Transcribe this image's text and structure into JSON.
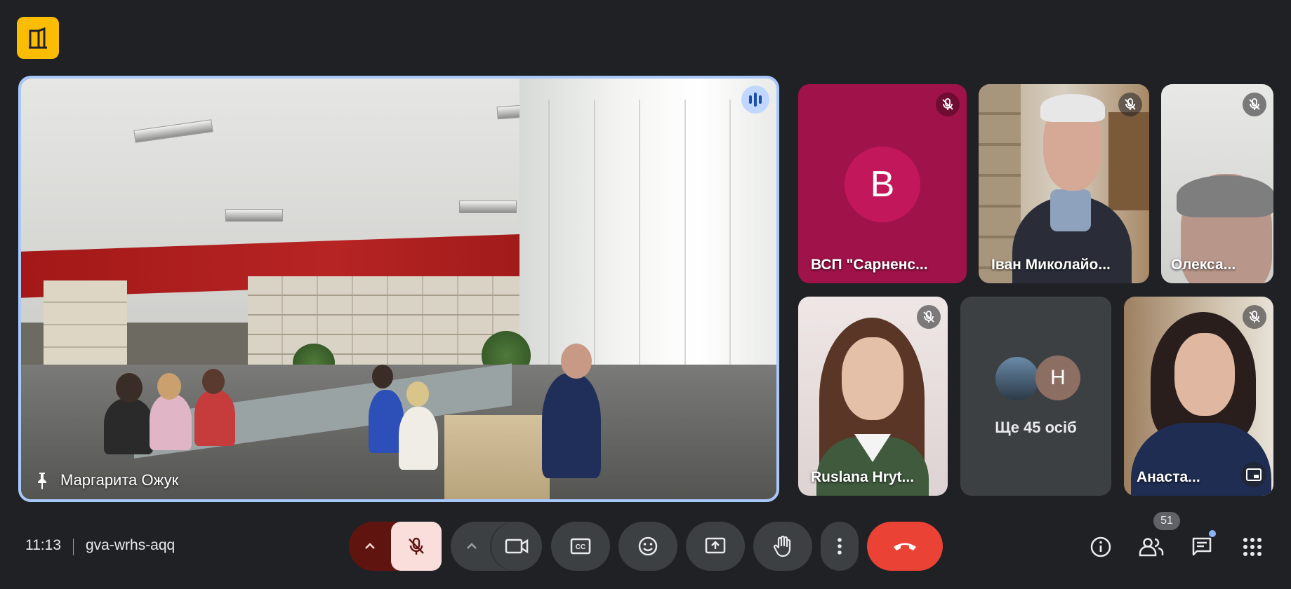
{
  "main": {
    "speaker_name": "Маргарита Ожук"
  },
  "tiles": [
    {
      "name": "ВСП \"Сарненс...",
      "avatar_letter": "В",
      "bg": "#a0124a",
      "avatar_bg": "#c2185b"
    },
    {
      "name": "Іван Миколайо..."
    },
    {
      "name": "Олекса..."
    },
    {
      "name": "Ruslana Hryt..."
    },
    {
      "name": "Ще 45 осіб",
      "avatar_letter": "Н",
      "avatar_bg": "#8d6e63"
    },
    {
      "name": "Анаста..."
    }
  ],
  "bottom": {
    "time": "11:13",
    "meeting_code": "gva-wrhs-aqq",
    "participants_count": "51"
  },
  "colors": {
    "background": "#202124",
    "accent_border": "#a8c7fa",
    "end_call": "#ea4335",
    "mic_off_bg": "#f9dedc",
    "mic_caret_bg": "#601410",
    "room_badge": "#fbbc04"
  },
  "icons": [
    "door-icon",
    "speaking-icon",
    "pin-icon",
    "mic-off-icon",
    "chevron-up-icon",
    "camera-icon",
    "captions-icon",
    "emoji-icon",
    "present-icon",
    "raise-hand-icon",
    "more-vert-icon",
    "call-end-icon",
    "info-icon",
    "people-icon",
    "chat-icon",
    "apps-icon",
    "picture-in-picture-icon"
  ]
}
